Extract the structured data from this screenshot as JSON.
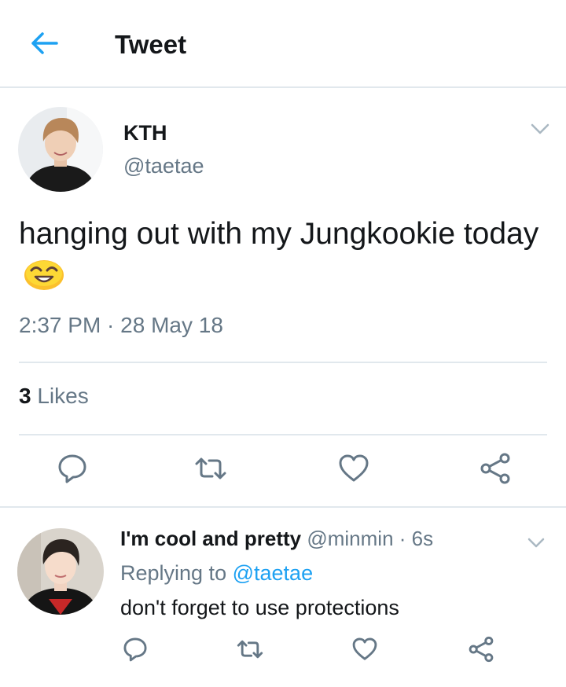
{
  "header": {
    "back_icon": "arrow-left-icon",
    "title": "Tweet",
    "accent_color": "#1da1f2"
  },
  "tweet": {
    "display_name": "KTH",
    "handle": "@taetae",
    "text": "hanging out with my Jungkookie today",
    "emoji": "smiling-face-emoji",
    "timestamp": "2:37 PM · 28 May 18",
    "likes_count": "3",
    "likes_label": "Likes",
    "actions": [
      "reply-icon",
      "retweet-icon",
      "like-icon",
      "share-icon"
    ]
  },
  "reply": {
    "display_name": "I'm cool and pretty",
    "handle": "@minmin",
    "separator": "·",
    "time": "6s",
    "replying_prefix": "Replying to",
    "replying_to": "@taetae",
    "text": "don't forget to use protections",
    "actions": [
      "reply-icon",
      "retweet-icon",
      "like-icon",
      "share-icon"
    ]
  },
  "colors": {
    "text_primary": "#14171a",
    "text_secondary": "#657786",
    "divider": "#e1e8ed",
    "link": "#1da1f2"
  }
}
